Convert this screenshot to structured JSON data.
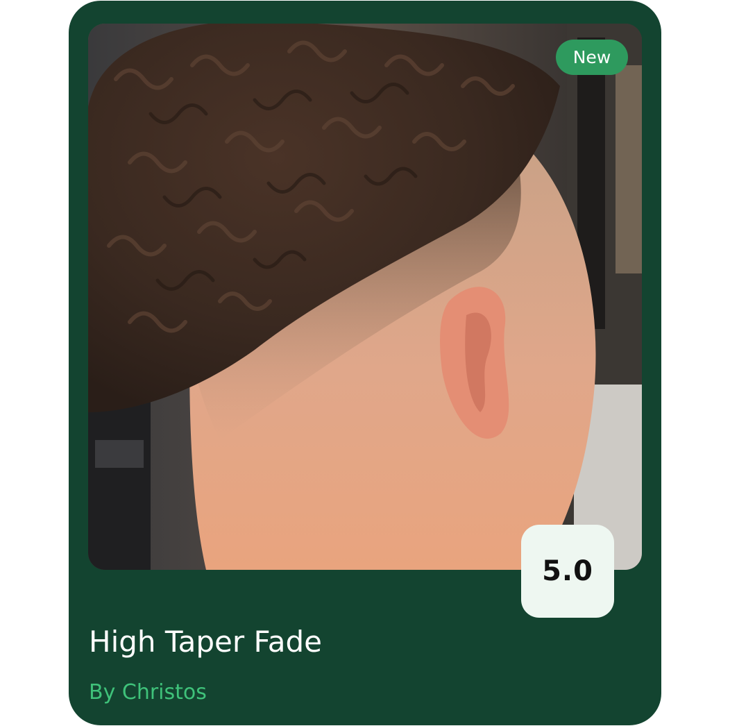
{
  "card": {
    "badge": "New",
    "rating": "5.0",
    "title": "High Taper Fade",
    "author": "By Christos"
  },
  "colors": {
    "card_background": "#134430",
    "badge_background": "#2e9a5e",
    "rating_background": "#eef7f1",
    "author_text": "#3fc27a"
  }
}
